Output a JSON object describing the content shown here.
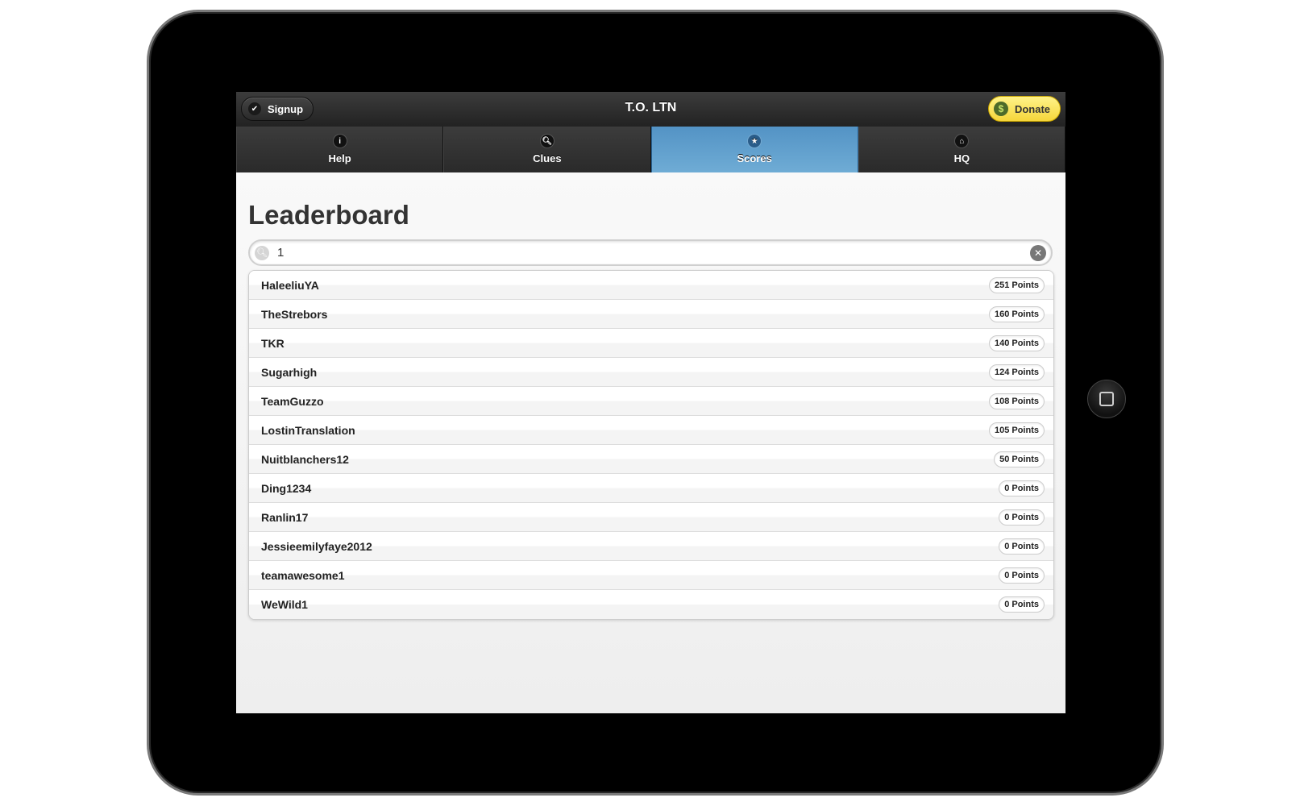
{
  "header": {
    "title": "T.O. LTN",
    "signup_label": "Signup",
    "donate_label": "Donate"
  },
  "nav": {
    "tabs": [
      {
        "label": "Help",
        "icon": "info-icon",
        "active": false
      },
      {
        "label": "Clues",
        "icon": "search-icon",
        "active": false
      },
      {
        "label": "Scores",
        "icon": "star-icon",
        "active": true
      },
      {
        "label": "HQ",
        "icon": "home-icon",
        "active": false
      }
    ]
  },
  "page": {
    "title": "Leaderboard"
  },
  "search": {
    "value": "1"
  },
  "leaderboard": [
    {
      "name": "HaleeliuYA",
      "points": "251 Points"
    },
    {
      "name": "TheStrebors",
      "points": "160 Points"
    },
    {
      "name": "TKR",
      "points": "140 Points"
    },
    {
      "name": "Sugarhigh",
      "points": "124 Points"
    },
    {
      "name": "TeamGuzzo",
      "points": "108 Points"
    },
    {
      "name": "LostinTranslation",
      "points": "105 Points"
    },
    {
      "name": "Nuitblanchers12",
      "points": "50 Points"
    },
    {
      "name": "Ding1234",
      "points": "0 Points"
    },
    {
      "name": "Ranlin17",
      "points": "0 Points"
    },
    {
      "name": "Jessieemilyfaye2012",
      "points": "0 Points"
    },
    {
      "name": "teamawesome1",
      "points": "0 Points"
    },
    {
      "name": "WeWild1",
      "points": "0 Points"
    }
  ],
  "colors": {
    "active_tab": "#5b9fd0",
    "donate": "#f8e05a",
    "header": "#2a2a2a"
  }
}
